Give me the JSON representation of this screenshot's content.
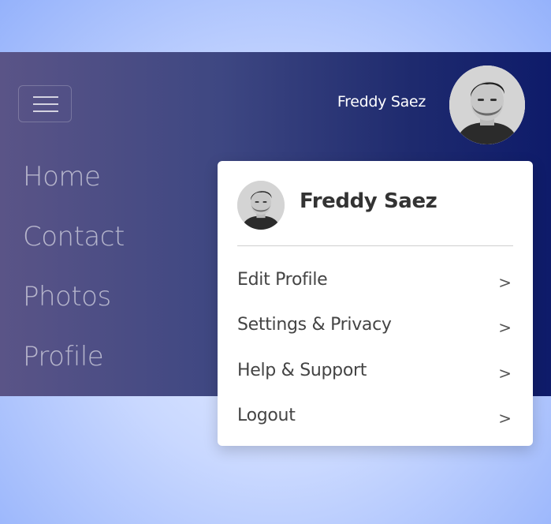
{
  "navbar": {
    "menu_toggle_icon": "hamburger-menu-icon",
    "items": [
      {
        "label": "Home"
      },
      {
        "label": "Contact"
      },
      {
        "label": "Photos"
      },
      {
        "label": "Profile"
      }
    ],
    "user_name": "Freddy Saez",
    "avatar_icon": "user-avatar"
  },
  "dropdown": {
    "user_name": "Freddy Saez",
    "items": [
      {
        "label": "Edit Profile",
        "chevron": ">"
      },
      {
        "label": "Settings & Privacy",
        "chevron": ">"
      },
      {
        "label": "Help & Support",
        "chevron": ">"
      },
      {
        "label": "Logout",
        "chevron": ">"
      }
    ]
  },
  "colors": {
    "navbar_gradient_start": "#5a5487",
    "navbar_gradient_end": "#0e1b6a",
    "background": "#c9d8ff",
    "dropdown_bg": "#ffffff",
    "text_dark": "#333333"
  }
}
